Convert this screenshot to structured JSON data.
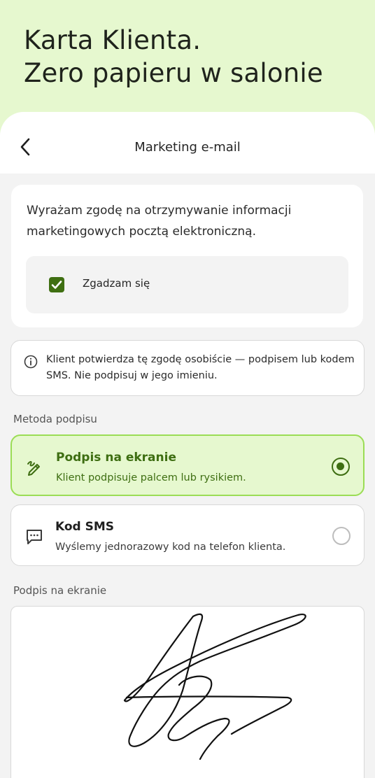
{
  "hero": {
    "title_line1": "Karta Klienta.",
    "title_line2": "Zero papieru w salonie"
  },
  "topbar": {
    "back_icon": "chevron-left-icon",
    "title": "Marketing e-mail"
  },
  "consent": {
    "text": "Wyrażam zgodę na otrzymywanie informacji marketingowych pocztą elektroniczną.",
    "checkbox_label": "Zgadzam się",
    "checked": true
  },
  "info": {
    "icon": "info-icon",
    "text": "Klient potwierdza tę zgodę osobiście — podpisem lub kodem SMS. Nie podpisuj w jego imieniu."
  },
  "signature_method": {
    "label": "Metoda podpisu",
    "options": [
      {
        "icon": "pen-signature-icon",
        "title": "Podpis na ekranie",
        "description": "Klient podpisuje palcem lub rysikiem.",
        "selected": true
      },
      {
        "icon": "message-dots-icon",
        "title": "Kod SMS",
        "description": "Wyślemy jednorazowy kod na telefon klienta.",
        "selected": false
      }
    ]
  },
  "signature_pad": {
    "label": "Podpis na ekranie"
  },
  "colors": {
    "hero_bg": "#E6F8CF",
    "accent_green": "#3E6E12",
    "selected_border": "#9BDD55"
  }
}
